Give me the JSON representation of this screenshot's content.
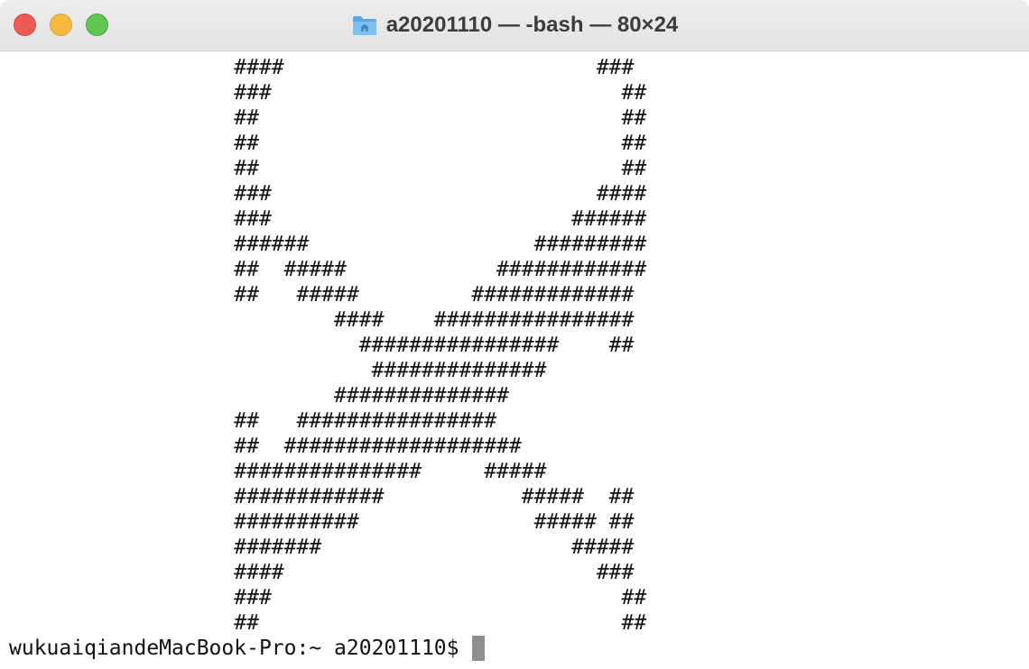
{
  "window": {
    "title": "a20201110 — -bash — 80×24",
    "title_icon": "home-folder-icon",
    "colors": {
      "close": "#ee5b56",
      "minimize": "#f5bb40",
      "maximize": "#61c454",
      "background": "#ffffff",
      "text": "#111111"
    }
  },
  "terminal": {
    "lines": [
      "                  ####                         ###",
      "                  ###                            ##",
      "                  ##                             ##",
      "                  ##                             ##",
      "                  ##                             ##",
      "                  ###                          ####",
      "                  ###                        ######",
      "                  ######                  #########",
      "                  ##  #####            ############",
      "                  ##   #####         #############",
      "                          ####    ################",
      "                            ################    ##",
      "                             ##############",
      "                          ##############",
      "                  ##   ################",
      "                  ##  ###################",
      "                  ###############     #####",
      "                  ############           #####  ##",
      "                  ##########              ##### ##",
      "                  #######                    #####",
      "                  ####                         ###",
      "                  ###                            ##",
      "                  ##                             ##"
    ],
    "prompt": "wukuaiqiandeMacBook-Pro:~ a20201110$"
  }
}
